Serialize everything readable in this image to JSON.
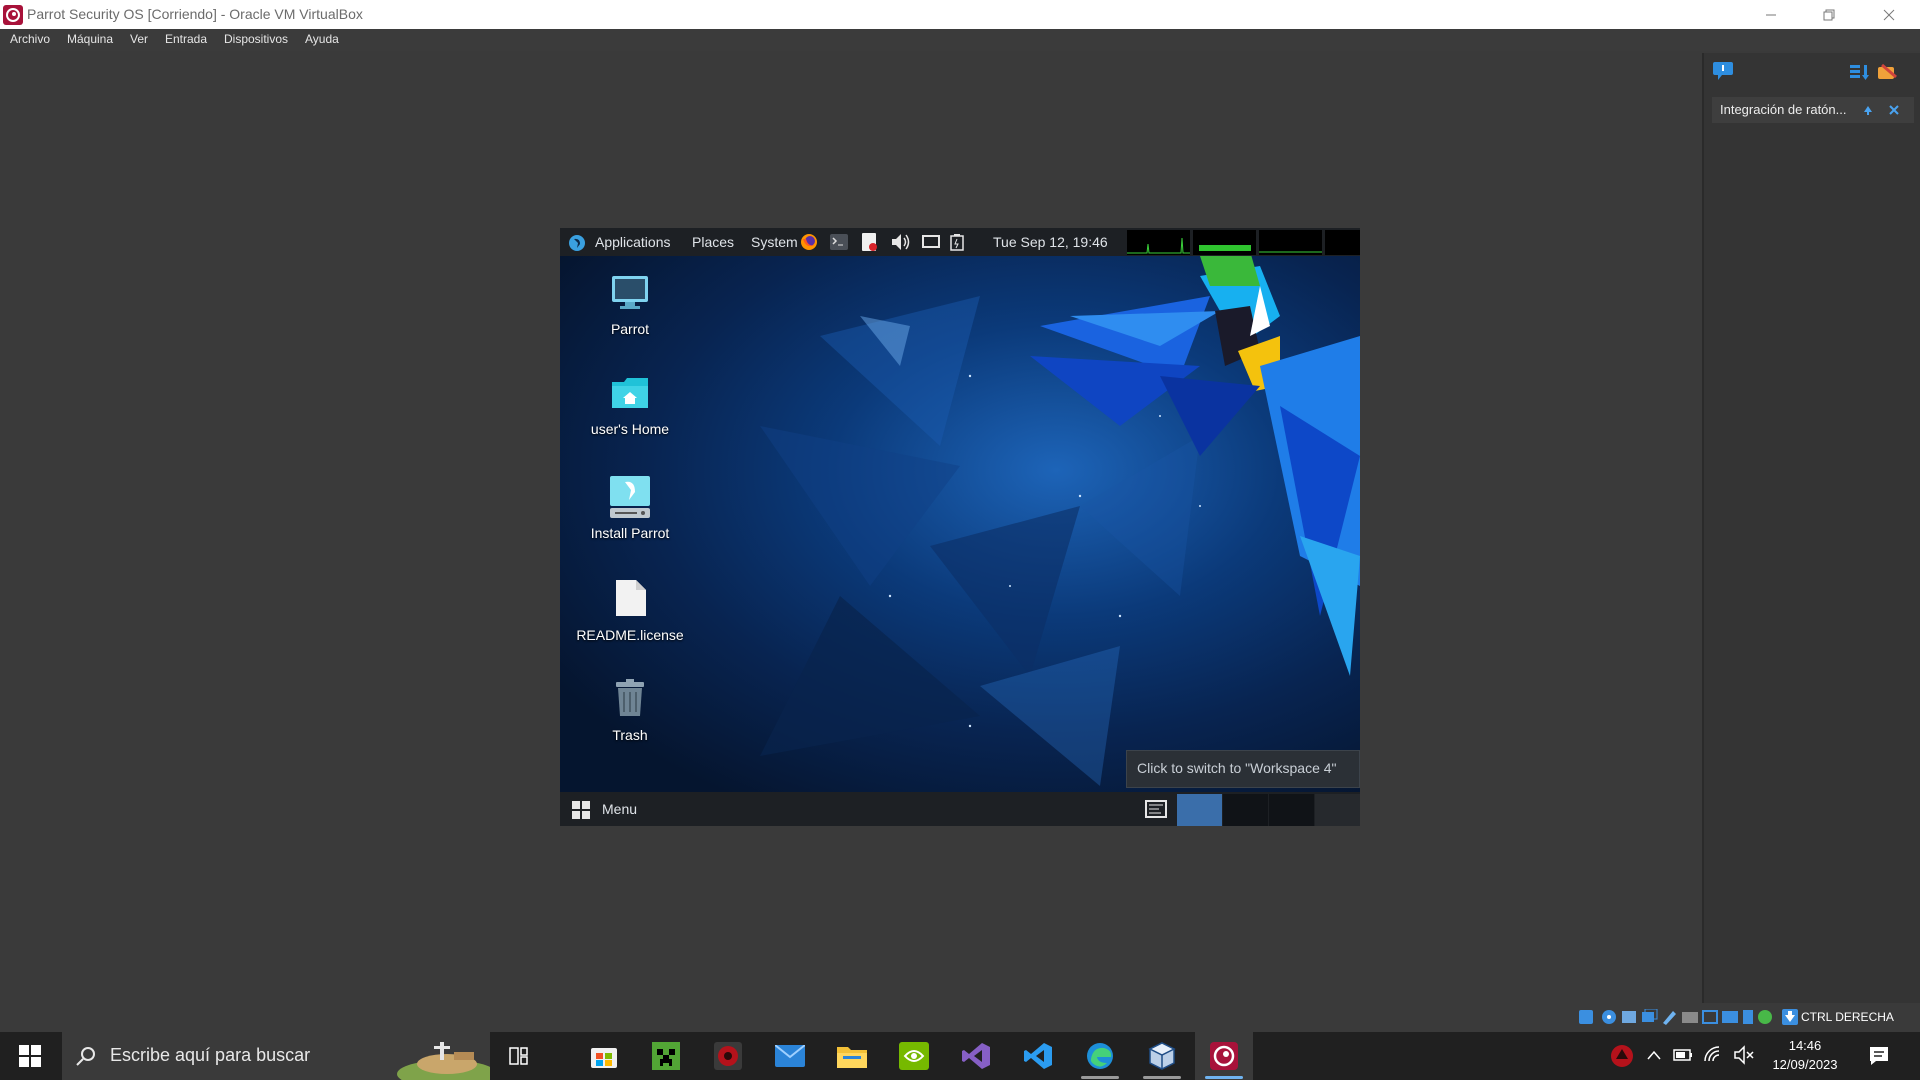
{
  "window": {
    "title": "Parrot Security OS [Corriendo] - Oracle VM VirtualBox",
    "controls": [
      "minimize",
      "restore",
      "close"
    ]
  },
  "menubar": {
    "items": [
      "Archivo",
      "Máquina",
      "Ver",
      "Entrada",
      "Dispositivos",
      "Ayuda"
    ]
  },
  "dock": {
    "notification": "Integración de ratón..."
  },
  "guest": {
    "panel": {
      "applications": "Applications",
      "places": "Places",
      "system": "System",
      "clock": "Tue Sep 12, 19:46"
    },
    "desktop_icons": [
      {
        "label": "Parrot",
        "icon": "monitor-icon"
      },
      {
        "label": "user's Home",
        "icon": "home-folder-icon"
      },
      {
        "label": "Install Parrot",
        "icon": "installer-icon"
      },
      {
        "label": "README.license",
        "icon": "file-icon"
      },
      {
        "label": "Trash",
        "icon": "trash-icon"
      }
    ],
    "tooltip": "Click to switch to \"Workspace 4\"",
    "bottom_panel": {
      "menu": "Menu"
    }
  },
  "statusbar": {
    "host_key": "CTRL DERECHA"
  },
  "taskbar": {
    "search_placeholder": "Escribe aquí para buscar",
    "time": "14:46",
    "date": "12/09/2023"
  },
  "colors": {
    "accent_blue": "#3a6eaa",
    "vbox_red": "#c8102e",
    "workspace_active": "#3a6eaa"
  }
}
